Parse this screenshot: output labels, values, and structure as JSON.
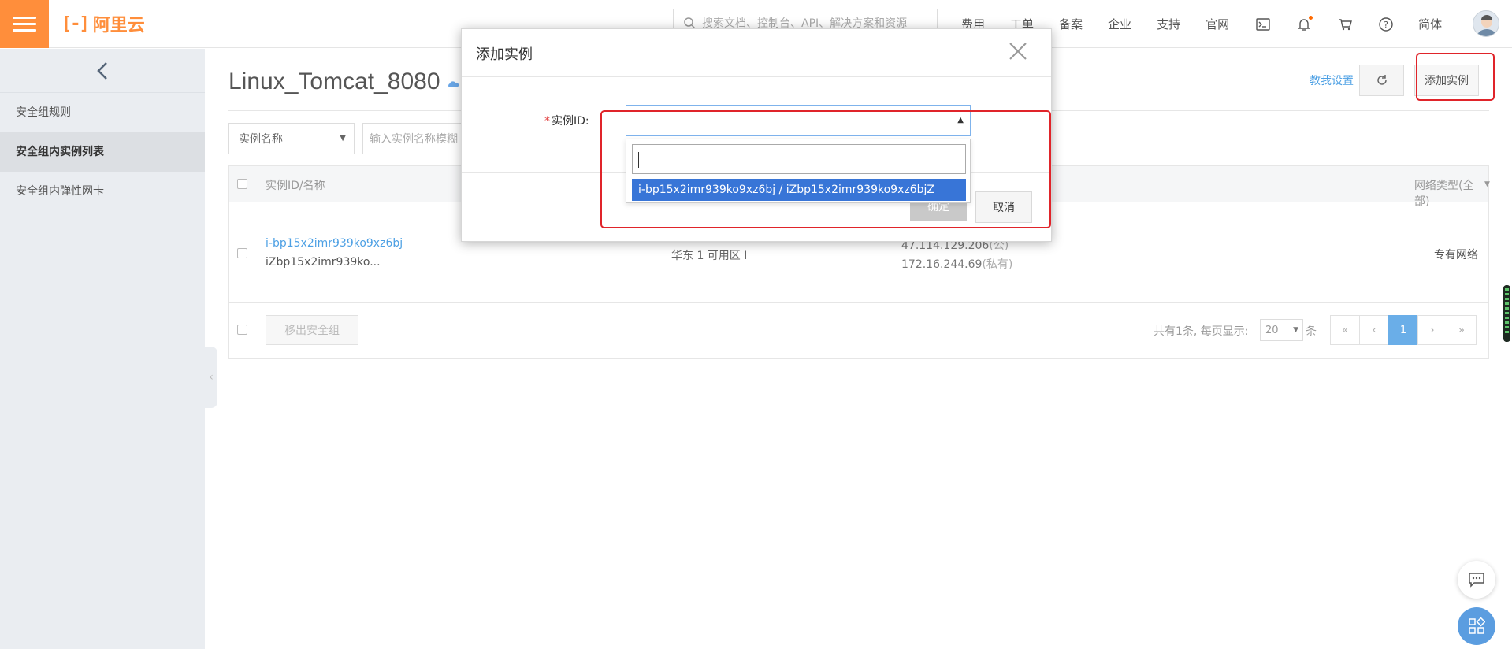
{
  "header": {
    "brand": "阿里云",
    "brand_mark": "[-]",
    "search_placeholder": "搜索文档、控制台、API、解决方案和资源",
    "nav": [
      "费用",
      "工单",
      "备案",
      "企业",
      "支持",
      "官网"
    ],
    "lang": "简体",
    "icons": [
      "terminal-icon",
      "bell-icon",
      "cart-icon",
      "help-icon"
    ],
    "accent_color": "#ff8e3b"
  },
  "sidebar": {
    "items": [
      {
        "label": "安全组规则"
      },
      {
        "label": "安全组内实例列表"
      },
      {
        "label": "安全组内弹性网卡"
      }
    ]
  },
  "main": {
    "title": "Linux_Tomcat_8080",
    "help_link": "教我设置",
    "add_button": "添加实例",
    "filter": {
      "select": "实例名称",
      "input_placeholder": "输入实例名称模糊"
    },
    "table": {
      "headers": {
        "id_name": "实例ID/名称",
        "net_type": "网络类型(全部)"
      },
      "rows": [
        {
          "id": "i-bp15x2imr939ko9xz6bj",
          "name": "iZbp15x2imr939ko...",
          "zone": "华东 1 可用区 I",
          "ip_public": "47.114.129.206",
          "ip_public_tag": "(公)",
          "ip_private": "172.16.244.69",
          "ip_private_tag": "(私有)",
          "net_type": "专有网络"
        }
      ],
      "footer": {
        "move_button": "移出安全组",
        "summary": "共有1条, 每页显示:",
        "page_size": "20",
        "unit": "条",
        "pages": [
          "«",
          "‹",
          "1",
          "›",
          "»"
        ]
      }
    }
  },
  "dialog": {
    "title": "添加实例",
    "field_required": "*",
    "field_label": "实例ID:",
    "option": "i-bp15x2imr939ko9xz6bj / iZbp15x2imr939ko9xz6bjZ",
    "ok": "确定",
    "cancel": "取消"
  }
}
